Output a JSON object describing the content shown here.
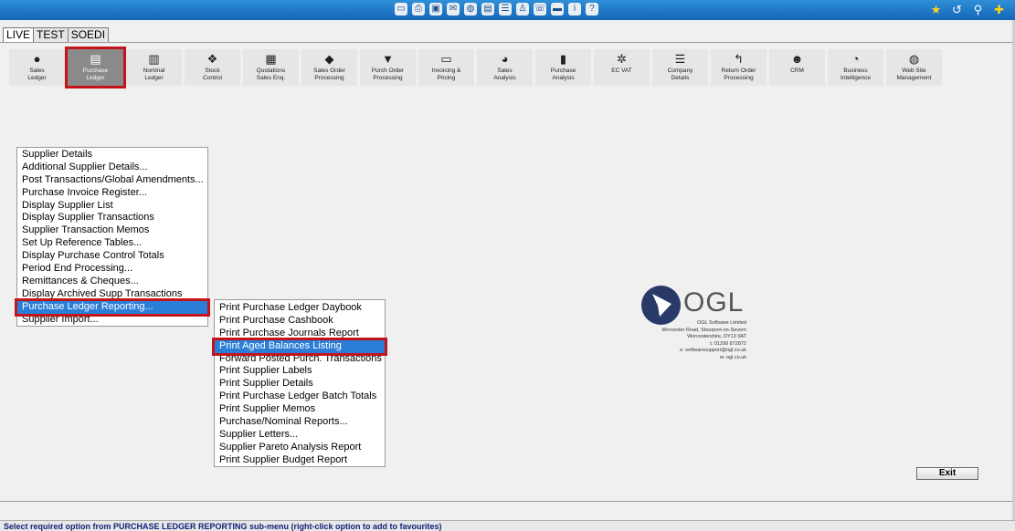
{
  "topbar": {
    "center_icons": [
      "window-icon",
      "printer-icon",
      "floppy-icon",
      "mail-icon",
      "globe-icon",
      "window-alt-icon",
      "list-icon",
      "stamp-icon",
      "phone-icon",
      "id-card-icon",
      "info-icon",
      "help-icon"
    ],
    "right_icons": [
      "favourites-star-icon",
      "history-icon",
      "search-icon",
      "add-favourite-icon"
    ],
    "accent": "#1a74c8"
  },
  "tabs": [
    {
      "label": "LIVE",
      "active": true
    },
    {
      "label": "TEST",
      "active": false
    },
    {
      "label": "SOEDI",
      "active": false
    }
  ],
  "modules": [
    {
      "label": "Sales\nLedger",
      "icon": "person-icon"
    },
    {
      "label": "Purchase\nLedger",
      "icon": "ledger-card-icon",
      "selected": true
    },
    {
      "label": "Nominal\nLedger",
      "icon": "book-icon"
    },
    {
      "label": "Stock\nControl",
      "icon": "boxes-icon"
    },
    {
      "label": "Quotations\nSales Enq.",
      "icon": "calculator-icon"
    },
    {
      "label": "Sales Order\nProcessing",
      "icon": "tag-icon"
    },
    {
      "label": "Purch Order\nProcessing",
      "icon": "cart-icon"
    },
    {
      "label": "Invoicing &\nPricing",
      "icon": "card-icon"
    },
    {
      "label": "Sales\nAnalysis",
      "icon": "pie-chart-icon"
    },
    {
      "label": "Purchase\nAnalysis",
      "icon": "bar-chart-icon"
    },
    {
      "label": "EC VAT",
      "icon": "stars-circle-icon"
    },
    {
      "label": "Company\nDetails",
      "icon": "list-icon"
    },
    {
      "label": "Return Order\nProcessing",
      "icon": "return-arrow-icon"
    },
    {
      "label": "CRM",
      "icon": "people-icon"
    },
    {
      "label": "Business\nIntelligence",
      "icon": "gauge-icon"
    },
    {
      "label": "Web Site\nManagement",
      "icon": "globe-icon"
    }
  ],
  "main_menu": [
    "Supplier Details",
    "Additional Supplier Details...",
    "Post Transactions/Global Amendments...",
    "Purchase Invoice Register...",
    "Display Supplier List",
    "Display Supplier Transactions",
    "Supplier Transaction Memos",
    "Set Up Reference Tables...",
    "Display Purchase Control Totals",
    "Period End Processing...",
    "Remittances & Cheques...",
    "Display Archived Supp Transactions",
    "Purchase Ledger Reporting...",
    "Supplier Import..."
  ],
  "main_menu_selected": 12,
  "sub_menu": [
    "Print Purchase Ledger Daybook",
    "Print Purchase Cashbook",
    "Print Purchase Journals Report",
    "Print Aged Balances Listing",
    "Forward Posted Purch. Transactions",
    "Print Supplier Labels",
    "Print Supplier Details",
    "Print Purchase Ledger Batch Totals",
    "Print Supplier Memos",
    "Purchase/Nominal Reports...",
    "Supplier Letters...",
    "Supplier Pareto Analysis Report",
    "Print Supplier Budget Report"
  ],
  "sub_menu_selected": 3,
  "logo": {
    "brand": "OGL",
    "address": "OGL Software Limited\nWorcester Road, Stourport-on-Severn\nWorcestershire, DY13 9AT\nt: 01299 872872\ne: softwaresupport@ogl.co.uk\nw: ogl.co.uk"
  },
  "exit_label": "Exit",
  "status_text": "Select required option from PURCHASE LEDGER REPORTING sub-menu (right-click option to add to favourites)"
}
